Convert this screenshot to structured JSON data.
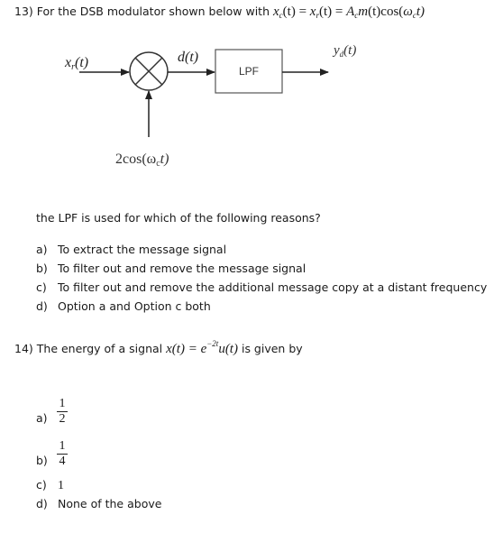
{
  "q13": {
    "prefix": "13) For the DSB modulator shown below with",
    "equation": {
      "lhs": "x",
      "lhs_sub": "c",
      "t1": "(t) = ",
      "mid": "x",
      "mid_sub": "r",
      "t2": "(t) = ",
      "amp": "A",
      "amp_sub": "c",
      "msg": "m",
      "t3": "(t)",
      "cos": "cos",
      "open": "(",
      "omega": "ω",
      "omega_sub": "c",
      "t4": "t)"
    },
    "diagram": {
      "input_label": "x",
      "input_sub": "r",
      "input_arg": "(t)",
      "mixer_output_label": "d(t)",
      "filter_label": "LPF",
      "output_label": "y",
      "output_sub": "d",
      "output_arg": "(t)",
      "carrier_label_pre": "2cos(ω",
      "carrier_sub": "c",
      "carrier_label_post": "t)"
    },
    "question": "the LPF is used for which of the following reasons?",
    "options": [
      {
        "letter": "a)",
        "text": "To extract the message signal"
      },
      {
        "letter": "b)",
        "text": "To filter out and remove the message signal"
      },
      {
        "letter": "c)",
        "text": "To filter out and remove the additional message copy at a distant frequency"
      },
      {
        "letter": "d)",
        "text": "Option a and Option c both"
      }
    ]
  },
  "q14": {
    "prefix": "14) The energy of a signal",
    "equation": {
      "lhs": "x(t) = e",
      "exp": "−2t",
      "rhs": "u(t)"
    },
    "suffix": "is given by",
    "options": [
      {
        "letter": "a)",
        "num": "1",
        "den": "2"
      },
      {
        "letter": "b)",
        "num": "1",
        "den": "4"
      },
      {
        "letter": "c)",
        "text": "1"
      },
      {
        "letter": "d)",
        "text": "None of the above"
      }
    ]
  }
}
